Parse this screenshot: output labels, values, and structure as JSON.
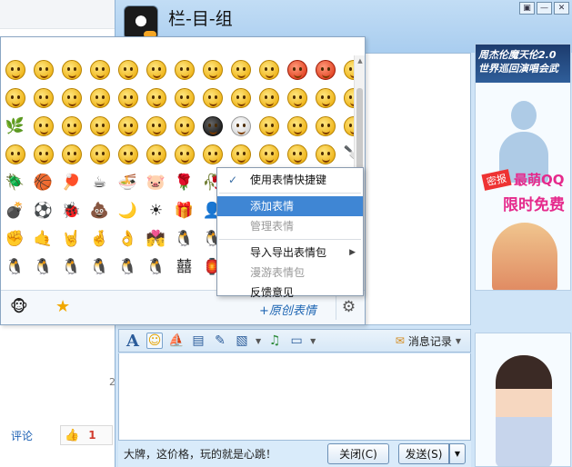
{
  "window": {
    "contact_name": "栏-目-组",
    "controls": [
      "▣",
      "—",
      "✕"
    ]
  },
  "ads": {
    "top_banner": "周杰伦魔天伦2.0 世界巡回演唱会武",
    "tag": "密报",
    "line1": "最萌QQ",
    "line2": "限时免费"
  },
  "emoji_panel": {
    "scrollbar_up": "▲",
    "scrollbar_down": "▼",
    "grid": [
      [
        "face",
        "face",
        "face",
        "face",
        "face",
        "face",
        "face",
        "face",
        "face",
        "face",
        "red",
        "red",
        "face"
      ],
      [
        "face",
        "face",
        "face",
        "face",
        "face",
        "face",
        "face",
        "face",
        "face",
        "face",
        "face",
        "face",
        "face"
      ],
      [
        "🌿",
        "face",
        "face",
        "face",
        "face",
        "face",
        "face",
        "dark",
        "white",
        "face",
        "face",
        "face",
        "face"
      ],
      [
        "face",
        "face",
        "face",
        "face",
        "face",
        "face",
        "face",
        "face",
        "face",
        "face",
        "face",
        "face",
        "🔪"
      ],
      [
        "🪲",
        "🏀",
        "🏓",
        "☕",
        "🍜",
        "🐷",
        "🌹",
        "🥀",
        "💋",
        "💖",
        "💔",
        "🎂",
        "⚡"
      ],
      [
        "💣",
        "⚽",
        "🐞",
        "💩",
        "🌙",
        "☀",
        "🎁",
        "👤",
        "🤝",
        "👍",
        "👎",
        "🤝",
        "✌"
      ],
      [
        "✊",
        "🤙",
        "🤘",
        "🤞",
        "👌",
        "💏",
        "🐧",
        "🐧",
        "🐧",
        "🐧",
        "🐧",
        "🐧",
        "🐧"
      ],
      [
        "🐧",
        "🐧",
        "🐧",
        "🐧",
        "🐧",
        "🐧",
        "囍",
        "🏮",
        "🐧",
        "🐧",
        "🐧",
        "🐧",
        "🐧"
      ]
    ],
    "tabs": [
      {
        "name": "monkey-tab",
        "icon": "🐵"
      },
      {
        "name": "favorites-tab",
        "icon": "★"
      }
    ],
    "original_emoji_link": "+原创表情",
    "settings_icon": "⚙"
  },
  "context_menu": {
    "items": [
      {
        "label": "使用表情快捷键",
        "checked": true,
        "check_mark": "✓",
        "state": "normal"
      },
      {
        "label": "添加表情",
        "state": "hover"
      },
      {
        "label": "管理表情",
        "state": "disabled"
      },
      {
        "label": "导入导出表情包",
        "state": "normal",
        "submenu": true,
        "arrow": "▶"
      },
      {
        "label": "漫游表情包",
        "state": "disabled"
      },
      {
        "label": "反馈意见",
        "state": "normal"
      }
    ]
  },
  "toolbar": {
    "font_icon": "A",
    "emoji_icon": "☺",
    "shake_icon": "⛵",
    "screenshot_icon": "▤",
    "note_icon": "✎",
    "image_icon": "▧",
    "music_icon": "♫",
    "screen_icon": "▭",
    "dropdown_caret": "▼",
    "message_log_icon": "✉",
    "message_log_label": "消息记录"
  },
  "input": {
    "tip": "大牌，这价格，玩的就是心跳！"
  },
  "buttons": {
    "close_label": "关闭(C)",
    "send_label": "发送(S)",
    "send_dropdown": "▼"
  },
  "background_page": {
    "number": "2",
    "comment_label": "评论",
    "like_icon": "👍",
    "like_count": "1"
  }
}
